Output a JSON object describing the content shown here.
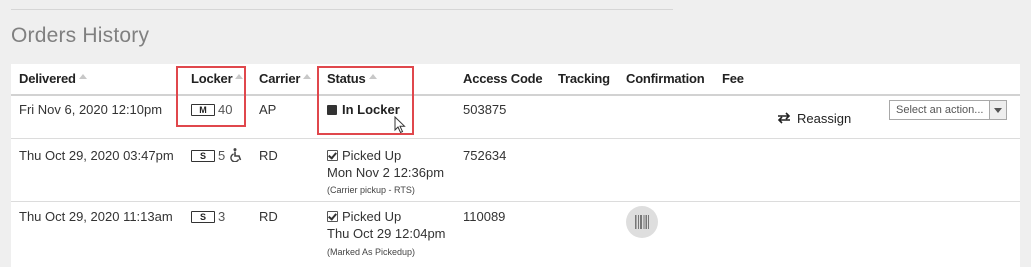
{
  "page": {
    "title": "Orders History"
  },
  "table": {
    "headers": {
      "delivered": "Delivered",
      "locker": "Locker",
      "carrier": "Carrier",
      "status": "Status",
      "access_code": "Access Code",
      "tracking": "Tracking",
      "confirmation": "Confirmation",
      "fee": "Fee"
    },
    "rows": [
      {
        "delivered": "Fri Nov 6, 2020 12:10pm",
        "locker_size": "M",
        "locker_number": "40",
        "carrier": "AP",
        "status": "In Locker",
        "access_code": "503875",
        "reassign_label": "Reassign",
        "action_select": "Select an action..."
      },
      {
        "delivered": "Thu Oct 29, 2020 03:47pm",
        "locker_size": "S",
        "locker_number": "5",
        "carrier": "RD",
        "status": "Picked Up",
        "status_time": "Mon Nov 2 12:36pm",
        "status_note": "(Carrier pickup - RTS)",
        "access_code": "752634"
      },
      {
        "delivered": "Thu Oct 29, 2020 11:13am",
        "locker_size": "S",
        "locker_number": "3",
        "carrier": "RD",
        "status": "Picked Up",
        "status_time": "Thu Oct 29 12:04pm",
        "status_note": "(Marked As Pickedup)",
        "access_code": "110089"
      }
    ]
  },
  "colors": {
    "highlight": "#e0474c",
    "background": "#efefef"
  },
  "icons": [
    "sort-arrow-icon",
    "accessibility-icon",
    "status-square-icon",
    "checkbox-checked-icon",
    "swap-arrows-icon",
    "dropdown-arrow-icon",
    "barcode-icon",
    "mouse-cursor-icon"
  ]
}
